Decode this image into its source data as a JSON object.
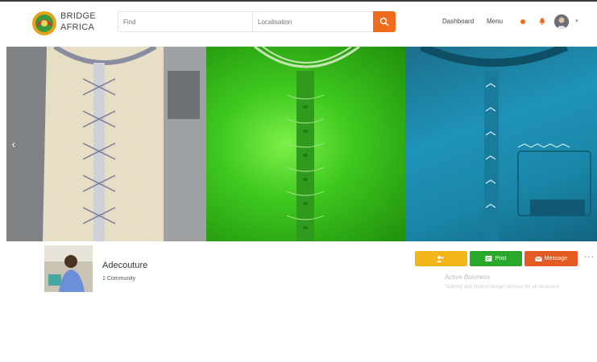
{
  "header": {
    "logo_line1": "BRIDGE",
    "logo_line2": "AFRICA",
    "search_placeholder": "Find",
    "location_placeholder": "Localisation",
    "nav_home": "Dashboard",
    "nav_about": "Menu",
    "search_icon": "search-icon",
    "bell_icon": "bell-icon",
    "avatar_icon": "avatar",
    "caret": "▾"
  },
  "banner": {
    "prev_arrow": "‹",
    "slides": [
      "white-embroidered-shirt",
      "green-embroidered-shirt",
      "blue-embroidered-shirt"
    ]
  },
  "profile": {
    "name": "Adecouture",
    "subtitle": "1 Community",
    "buttons": {
      "follow": "",
      "post": "Post",
      "message": "Message"
    },
    "more": "···",
    "business_title": "Active Business",
    "business_desc": "Tailoring and fashion design services for all occasions"
  },
  "colors": {
    "accent": "#ef6c1f",
    "follow": "#f2b61a",
    "post": "#2aa82a",
    "message": "#e35a22"
  }
}
